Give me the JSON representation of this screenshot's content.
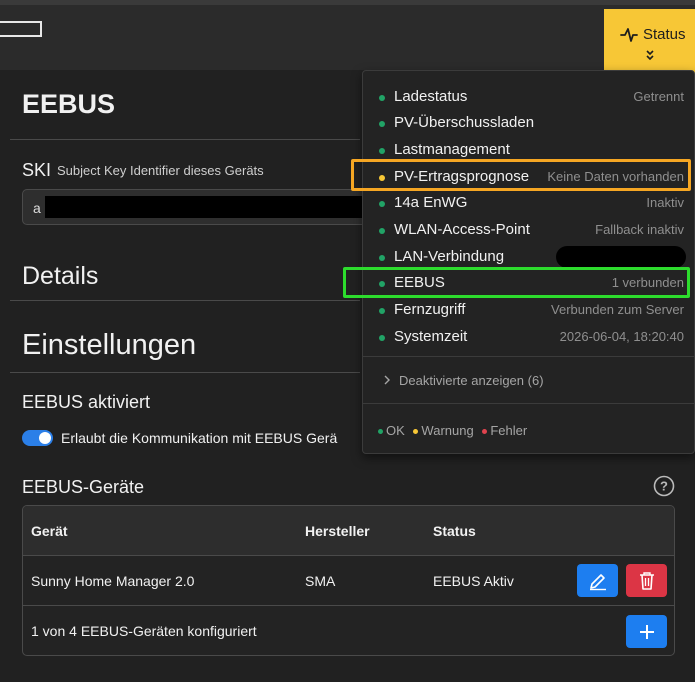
{
  "header": {
    "status_label": "Status"
  },
  "colors": {
    "ok": "#21a366",
    "warn": "#f7c736",
    "error": "#e0434e",
    "accent": "#1d7ef0",
    "status_button": "#f7c736"
  },
  "page": {
    "title": "EEBUS",
    "ski_label": "SKI",
    "ski_sub": "Subject Key Identifier dieses Geräts",
    "ski_value": "a",
    "details_heading": "Details",
    "settings_heading": "Einstellungen",
    "eebus_enabled_heading": "EEBUS aktiviert",
    "eebus_enabled_toggle_label": "Erlaubt die Kommunikation mit EEBUS Gerä",
    "devices_heading": "EEBUS-Geräte"
  },
  "devices_table": {
    "headers": [
      "Gerät",
      "Hersteller",
      "Status"
    ],
    "rows": [
      {
        "device": "Sunny Home Manager 2.0",
        "manufacturer": "SMA",
        "status": "EEBUS Aktiv"
      }
    ],
    "footer_text": "1 von 4 EEBUS-Geräten konfiguriert"
  },
  "status_menu": {
    "items": [
      {
        "name": "Ladestatus",
        "status": "Getrennt",
        "level": "ok"
      },
      {
        "name": "PV-Überschussladen",
        "status": "",
        "level": "ok"
      },
      {
        "name": "Lastmanagement",
        "status": "",
        "level": "ok"
      },
      {
        "name": "PV-Ertragsprognose",
        "status": "Keine Daten vorhanden",
        "level": "warn"
      },
      {
        "name": "14a EnWG",
        "status": "Inaktiv",
        "level": "ok"
      },
      {
        "name": "WLAN-Access-Point",
        "status": "Fallback inaktiv",
        "level": "ok"
      },
      {
        "name": "LAN-Verbindung",
        "status": "",
        "level": "ok"
      },
      {
        "name": "EEBUS",
        "status": "1 verbunden",
        "level": "ok"
      },
      {
        "name": "Fernzugriff",
        "status": "Verbunden zum Server",
        "level": "ok"
      },
      {
        "name": "Systemzeit",
        "status": "2026-06-04, 18:20:40",
        "level": "ok"
      }
    ],
    "show_deactivated": "Deaktivierte anzeigen (6)",
    "legend": {
      "ok": "OK",
      "warn": "Warnung",
      "error": "Fehler"
    }
  }
}
